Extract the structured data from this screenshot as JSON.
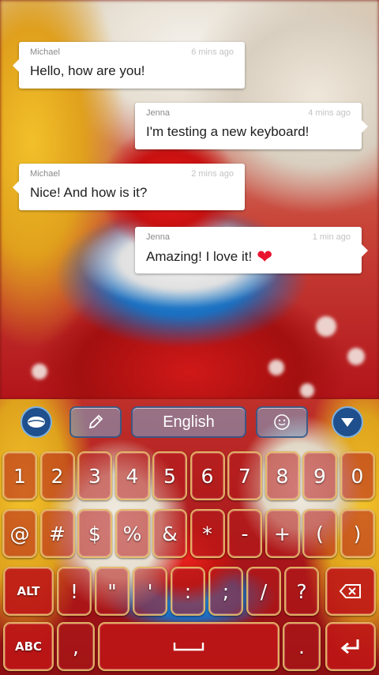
{
  "chat": {
    "messages": [
      {
        "sender": "Michael",
        "time": "6 mins ago",
        "text": "Hello, how are you!"
      },
      {
        "sender": "Jenna",
        "time": "4 mins ago",
        "text": "I'm testing a new keyboard!"
      },
      {
        "sender": "Michael",
        "time": "2 mins ago",
        "text": "Nice! And how is it?"
      },
      {
        "sender": "Jenna",
        "time": "1 min ago",
        "text": "Amazing! I love it!"
      }
    ]
  },
  "keyboard": {
    "language": "English",
    "icons": {
      "logo": "leaf-logo-icon",
      "edit": "pencil-icon",
      "emoji": "smiley-icon",
      "hide": "chevron-down-icon",
      "backspace": "backspace-icon",
      "enter": "enter-icon",
      "space": "space-icon"
    },
    "row1": [
      "1",
      "2",
      "3",
      "4",
      "5",
      "6",
      "7",
      "8",
      "9",
      "0"
    ],
    "row2": [
      "@",
      "#",
      "$",
      "%",
      "&",
      "*",
      "-",
      "+",
      "(",
      ")"
    ],
    "row3": [
      "!",
      "\"",
      "'",
      ":",
      ";",
      "/",
      "?"
    ],
    "alt_label": "ALT",
    "abc_label": "ABC",
    "comma": ",",
    "period": "."
  },
  "colors": {
    "accent_blue": "#1f4f8c",
    "heart": "#e8142e",
    "key_border": "#ebc86e"
  }
}
